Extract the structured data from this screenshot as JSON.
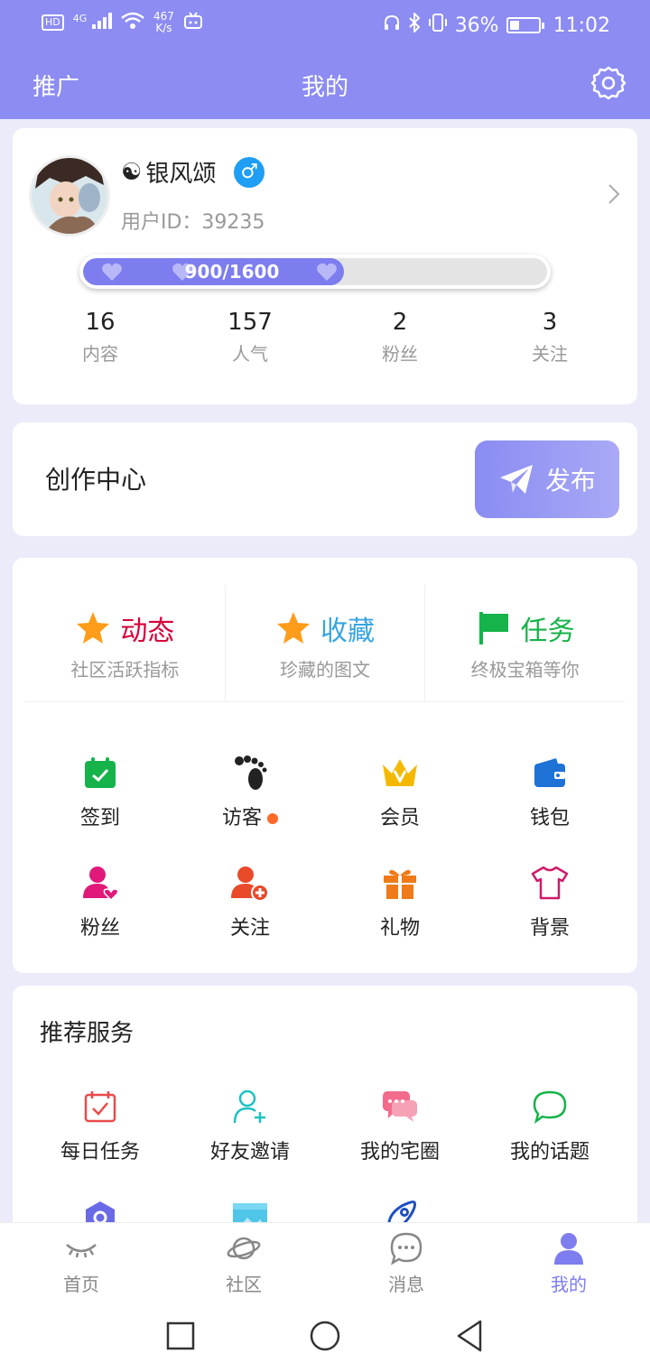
{
  "status_bar": {
    "network_badge": "HD",
    "signal_label": "4G",
    "speed_value": "467",
    "speed_unit": "K/s",
    "battery": "36%",
    "time": "11:02"
  },
  "header": {
    "promo": "推广",
    "title": "我的"
  },
  "profile": {
    "nickname_prefix": "☯",
    "nickname": "银风颂",
    "gender_symbol": "♂",
    "user_id": "用户ID：39235",
    "progress_text": "900/1600",
    "progress_fraction": 0.5625,
    "stats": [
      {
        "value": "16",
        "label": "内容"
      },
      {
        "value": "157",
        "label": "人气"
      },
      {
        "value": "2",
        "label": "粉丝"
      },
      {
        "value": "3",
        "label": "关注"
      }
    ]
  },
  "create": {
    "title": "创作中心",
    "publish_label": "发布"
  },
  "features": [
    {
      "title": "动态",
      "subtitle": "社区活跃指标",
      "color": "#d6003a",
      "icon": "star-icon"
    },
    {
      "title": "收藏",
      "subtitle": "珍藏的图文",
      "color": "#39a5e0",
      "icon": "star-icon"
    },
    {
      "title": "任务",
      "subtitle": "终极宝箱等你",
      "color": "#16b34a",
      "icon": "flag-icon"
    }
  ],
  "grid": [
    {
      "label": "签到",
      "icon": "calendar-check-icon",
      "color": "#16b34a"
    },
    {
      "label": "访客",
      "icon": "footprint-icon",
      "color": "#222222"
    },
    {
      "label": "会员",
      "icon": "crown-icon",
      "color": "#f5b800"
    },
    {
      "label": "钱包",
      "icon": "wallet-icon",
      "color": "#1e72d6"
    },
    {
      "label": "粉丝",
      "icon": "user-heart-icon",
      "color": "#e0197a"
    },
    {
      "label": "关注",
      "icon": "user-plus-icon",
      "color": "#e84a2a"
    },
    {
      "label": "礼物",
      "icon": "gift-icon",
      "color": "#f07a17"
    },
    {
      "label": "背景",
      "icon": "tshirt-icon",
      "color": "#cf1a6a"
    }
  ],
  "recommend": {
    "title": "推荐服务",
    "items": [
      {
        "label": "每日任务",
        "icon": "calendar-task-icon",
        "color": "#e84a4a"
      },
      {
        "label": "好友邀请",
        "icon": "user-invite-icon",
        "color": "#1ec2c2"
      },
      {
        "label": "我的宅圈",
        "icon": "chat-bubbles-icon",
        "color": "#f26b8a"
      },
      {
        "label": "我的话题",
        "icon": "chat-icon",
        "color": "#16b34a"
      }
    ]
  },
  "bottom_nav": [
    {
      "label": "首页",
      "icon": "eye-closed-icon"
    },
    {
      "label": "社区",
      "icon": "planet-icon"
    },
    {
      "label": "消息",
      "icon": "message-icon"
    },
    {
      "label": "我的",
      "icon": "user-icon",
      "active": true
    }
  ],
  "accent_color": "#8c8cf2"
}
